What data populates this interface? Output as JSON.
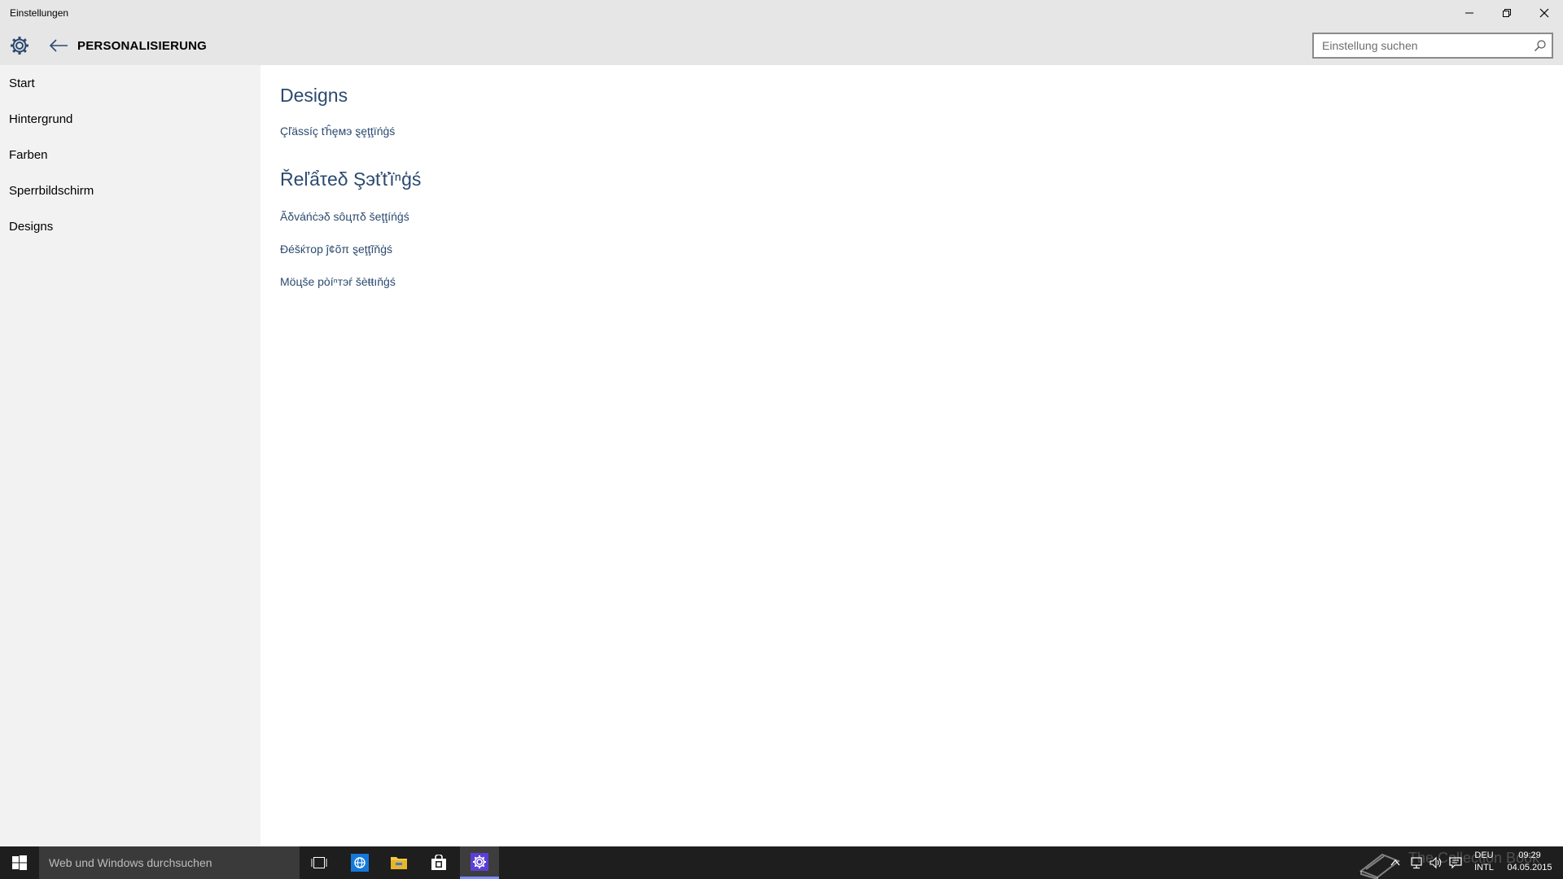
{
  "window": {
    "title": "Einstellungen"
  },
  "header": {
    "section_title": "PERSONALISIERUNG",
    "search_placeholder": "Einstellung suchen"
  },
  "sidebar": {
    "items": [
      {
        "label": "Start"
      },
      {
        "label": "Hintergrund"
      },
      {
        "label": "Farben"
      },
      {
        "label": "Sperrbildschirm"
      },
      {
        "label": "Designs"
      }
    ]
  },
  "main": {
    "designs_heading": "Designs",
    "classic_link": "Çľässíç ťĥȩмэ ȿȩţţïńģś",
    "related_heading": "Řеľẩτеδ Şэťťïⁿģś",
    "related_links": [
      {
        "label": "Ãδváńċэδ sôцπδ šеţţíńģś"
      },
      {
        "label": "Ðéšќтор ĵ¢õπ ȿеţţĩňģś"
      },
      {
        "label": "Möцšе рòíⁿтэŕ šèŧŧıňģś"
      }
    ]
  },
  "taskbar": {
    "search_placeholder": "Web und Windows durchsuchen",
    "watermark": "The Collection Book",
    "language_top": "DEU",
    "language_bottom": "INTL",
    "time": "09:29",
    "date": "04.05.2015"
  },
  "colors": {
    "accent": "#2b4a6f",
    "chrome": "#e6e6e6",
    "sidebar": "#f2f2f2",
    "taskbar": "#1e1e1e",
    "settings_app_icon": "#5b3fd6"
  }
}
